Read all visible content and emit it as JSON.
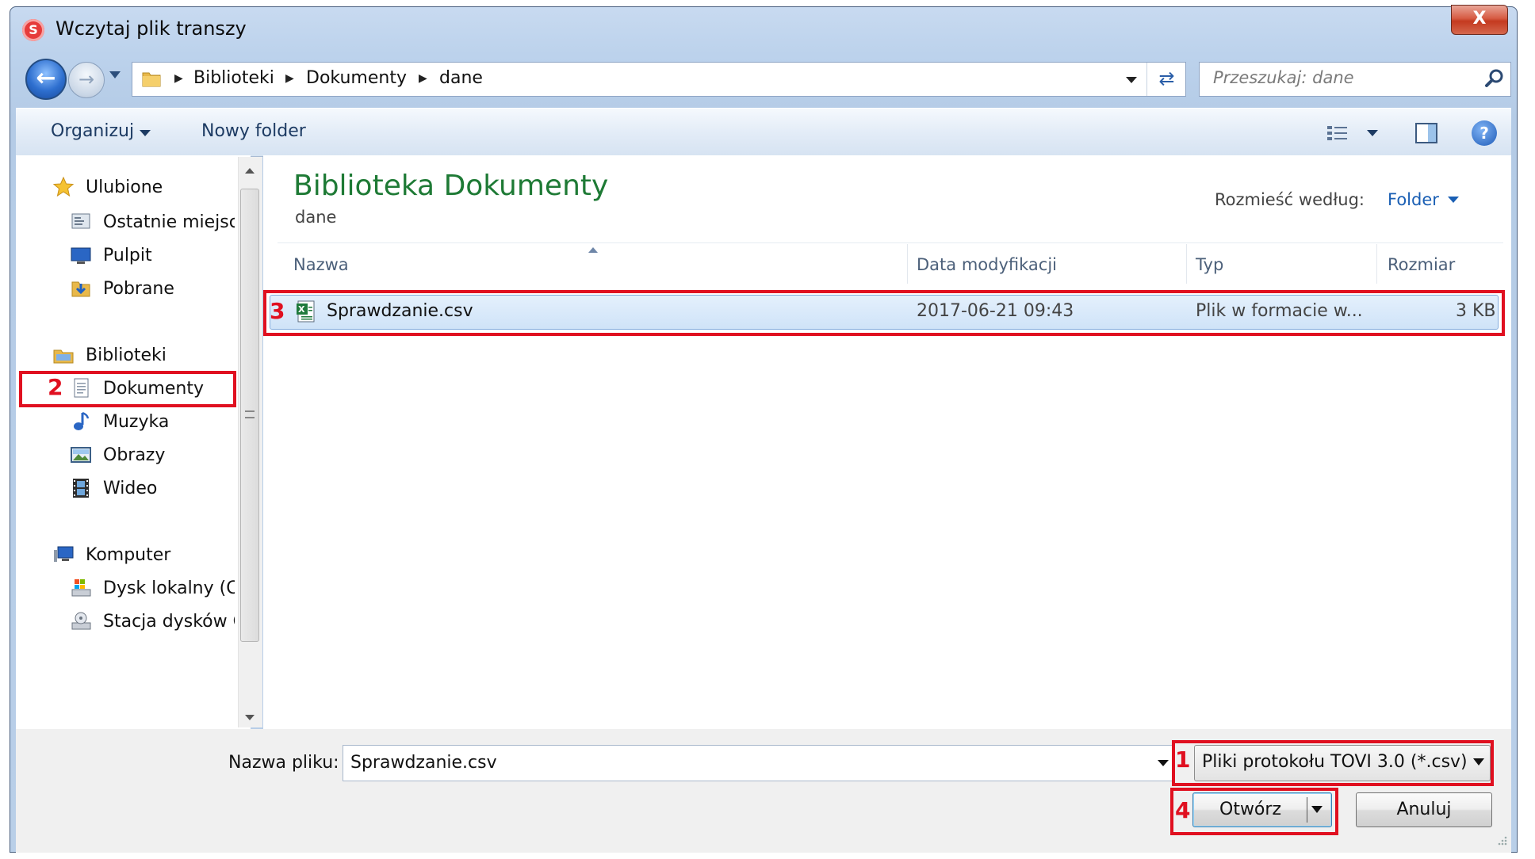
{
  "window": {
    "title": "Wczytaj plik transzy",
    "close_glyph": "X"
  },
  "address": {
    "breadcrumbs": [
      "Biblioteki",
      "Dokumenty",
      "dane"
    ],
    "search_placeholder": "Przeszukaj: dane"
  },
  "toolbar": {
    "organize_label": "Organizuj",
    "new_folder_label": "Nowy folder"
  },
  "sidebar": {
    "groups": [
      {
        "label": "Ulubione",
        "icon": "star-icon",
        "items": [
          {
            "label": "Ostatnie miejsca",
            "icon": "recent-places-icon"
          },
          {
            "label": "Pulpit",
            "icon": "desktop-icon"
          },
          {
            "label": "Pobrane",
            "icon": "downloads-icon"
          }
        ]
      },
      {
        "label": "Biblioteki",
        "icon": "libraries-icon",
        "items": [
          {
            "label": "Dokumenty",
            "icon": "documents-icon"
          },
          {
            "label": "Muzyka",
            "icon": "music-icon"
          },
          {
            "label": "Obrazy",
            "icon": "pictures-icon"
          },
          {
            "label": "Wideo",
            "icon": "video-icon"
          }
        ]
      },
      {
        "label": "Komputer",
        "icon": "computer-icon",
        "items": [
          {
            "label": "Dysk lokalny (C:)",
            "icon": "local-disk-icon"
          },
          {
            "label": "Stacja dysków CD",
            "icon": "cd-drive-icon"
          }
        ]
      }
    ]
  },
  "main": {
    "library_title": "Biblioteka Dokumenty",
    "library_subtitle": "dane",
    "arrange_label": "Rozmieść według:",
    "arrange_value": "Folder",
    "columns": [
      "Nazwa",
      "Data modyfikacji",
      "Typ",
      "Rozmiar"
    ],
    "files": [
      {
        "name": "Sprawdzanie.csv",
        "modified": "2017-06-21 09:43",
        "type": "Plik w formacie w...",
        "size": "3 KB",
        "icon": "excel-csv-icon"
      }
    ]
  },
  "bottom": {
    "filename_label": "Nazwa pliku:",
    "filename_value": "Sprawdzanie.csv",
    "filetype_value": "Pliki protokołu TOVI 3.0 (*.csv)",
    "open_label": "Otwórz",
    "cancel_label": "Anuluj"
  },
  "annotations": {
    "n1": "1",
    "n2": "2",
    "n3": "3",
    "n4": "4",
    "color": "#e01020"
  }
}
